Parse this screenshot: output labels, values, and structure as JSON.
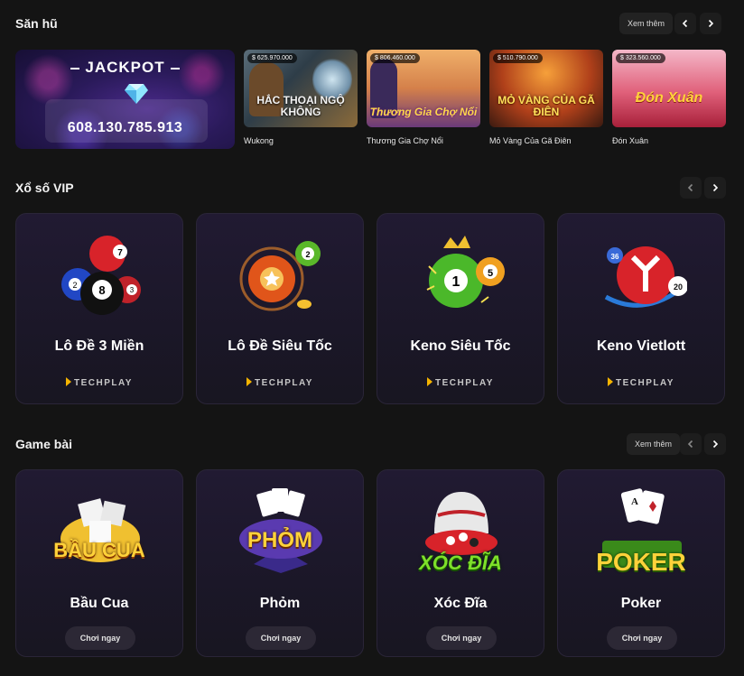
{
  "jackpot_section": {
    "title": "Săn hũ",
    "more_label": "Xem thêm",
    "jackpot": {
      "label": "JACKPOT",
      "amount": "608.130.785.913"
    },
    "games": [
      {
        "name": "Wukong",
        "amount": "$ 625.970.000",
        "art_text": "HẮC THOẠI NGỘ KHÔNG"
      },
      {
        "name": "Thương Gia Chợ Nổi",
        "amount": "$ 806.460.000",
        "art_text": "Thương Gia Chợ Nổi"
      },
      {
        "name": "Mỏ Vàng Của Gã Điên",
        "amount": "$ 510.790.000",
        "art_text": "MỎ VÀNG CỦA GÃ ĐIÊN"
      },
      {
        "name": "Đón Xuân",
        "amount": "$ 323.560.000",
        "art_text": "Đón Xuân"
      }
    ]
  },
  "lottery_section": {
    "title": "Xổ số VIP",
    "games": [
      {
        "name": "Lô Đề 3 Miền",
        "provider": "TECHPLAY"
      },
      {
        "name": "Lô Đề Siêu Tốc",
        "provider": "TECHPLAY"
      },
      {
        "name": "Keno Siêu Tốc",
        "provider": "TECHPLAY"
      },
      {
        "name": "Keno Vietlott",
        "provider": "TECHPLAY"
      }
    ]
  },
  "cards_section": {
    "title": "Game bài",
    "more_label": "Xem thêm",
    "games": [
      {
        "name": "Bầu Cua",
        "play_label": "Chơi ngay",
        "art_text": "BẦU CUA"
      },
      {
        "name": "Phỏm",
        "play_label": "Chơi ngay",
        "art_text": "PHỎM"
      },
      {
        "name": "Xóc Đĩa",
        "play_label": "Chơi ngay",
        "art_text": "XÓC ĐĨA"
      },
      {
        "name": "Poker",
        "play_label": "Chơi ngay",
        "art_text": "POKER"
      }
    ]
  },
  "colors": {
    "background": "#141414",
    "card": "#1c1727",
    "accent_gold": "#f5b400"
  }
}
